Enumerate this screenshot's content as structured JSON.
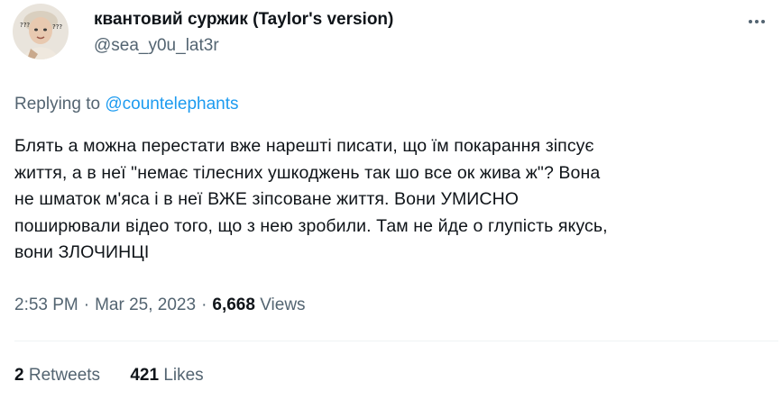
{
  "author": {
    "display_name": "квантовий суржик (Taylor's version)",
    "handle": "@sea_y0u_lat3r",
    "avatar_icon": "avatar-photo"
  },
  "reply": {
    "prefix": "Replying to",
    "mention": "@countelephants"
  },
  "tweet": {
    "text": "Блять а можна перестати вже нарешті писати, що їм покарання зіпсує\nжиття, а в неї \"немає тілесних ушкоджень так шо все ок жива ж\"? Вона\nне шматок м'яса і в неї ВЖЕ зіпсоване життя. Вони УМИСНО\nпоширювали відео того, що з нею зробили. Там не йде о глупість якусь,\nвони ЗЛОЧИНЦІ"
  },
  "meta": {
    "time": "2:53 PM",
    "separator": "·",
    "date": "Mar 25, 2023",
    "views_count": "6,668",
    "views_label": "Views"
  },
  "stats": {
    "retweets_count": "2",
    "retweets_label": "Retweets",
    "likes_count": "421",
    "likes_label": "Likes"
  },
  "colors": {
    "text": "#0f1419",
    "secondary": "#536471",
    "accent": "#1d9bf0",
    "divider": "#eff3f4"
  }
}
